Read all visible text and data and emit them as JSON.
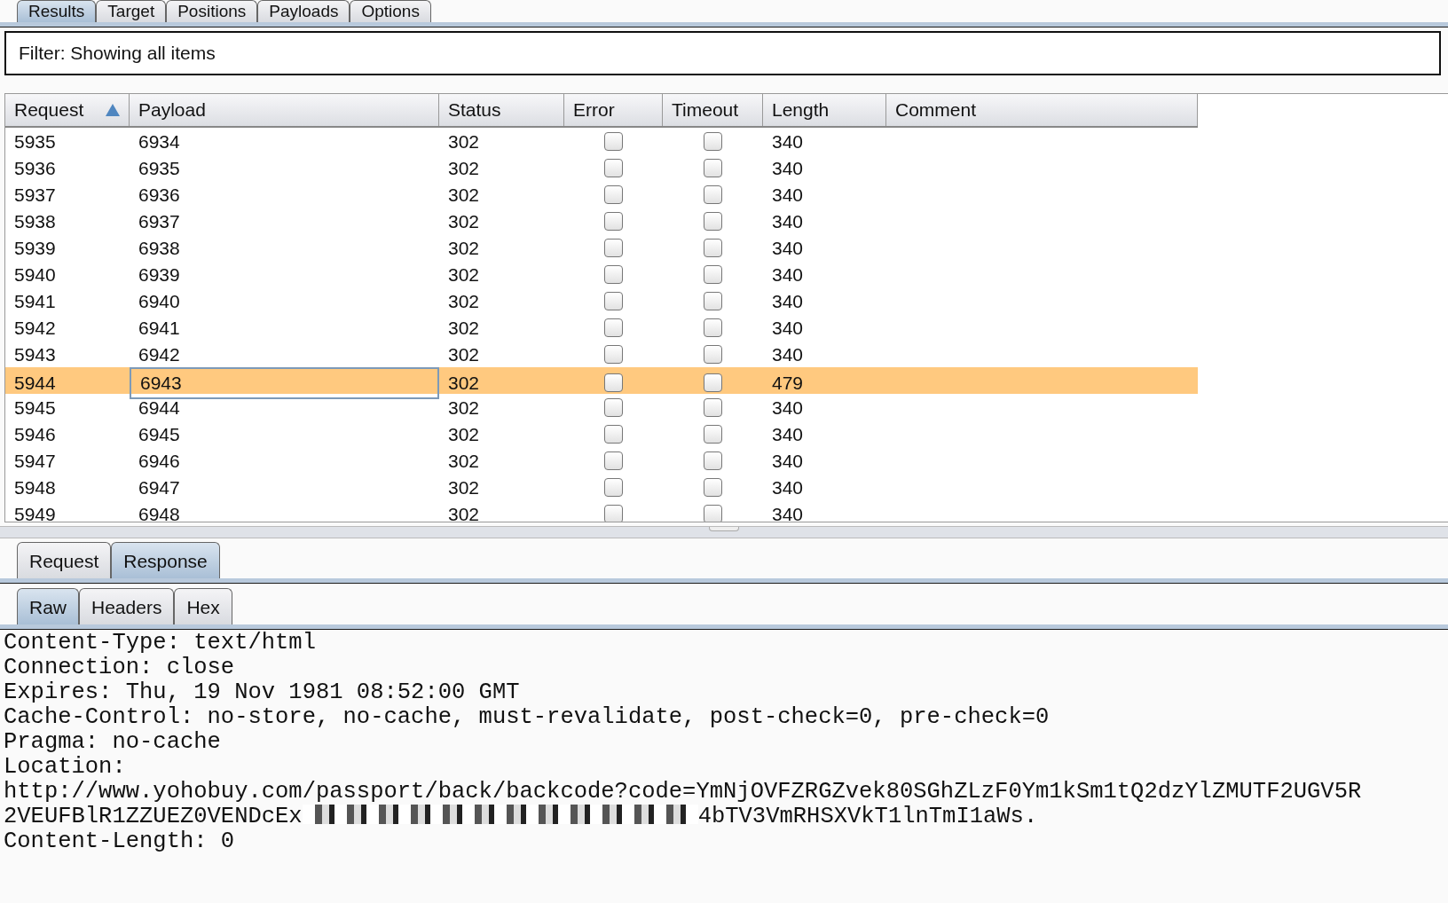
{
  "top_tabs": [
    {
      "label": "Results",
      "selected": true
    },
    {
      "label": "Target",
      "selected": false
    },
    {
      "label": "Positions",
      "selected": false
    },
    {
      "label": "Payloads",
      "selected": false
    },
    {
      "label": "Options",
      "selected": false
    }
  ],
  "filter": "Filter: Showing all items",
  "table": {
    "columns": [
      {
        "label": "Request",
        "sorted": true
      },
      {
        "label": "Payload",
        "sorted": false
      },
      {
        "label": "Status",
        "sorted": false
      },
      {
        "label": "Error",
        "sorted": false
      },
      {
        "label": "Timeout",
        "sorted": false
      },
      {
        "label": "Length",
        "sorted": false
      },
      {
        "label": "Comment",
        "sorted": false
      }
    ],
    "rows": [
      {
        "request": "5935",
        "payload": "6934",
        "status": "302",
        "error": false,
        "timeout": false,
        "length": "340",
        "selected": false
      },
      {
        "request": "5936",
        "payload": "6935",
        "status": "302",
        "error": false,
        "timeout": false,
        "length": "340",
        "selected": false
      },
      {
        "request": "5937",
        "payload": "6936",
        "status": "302",
        "error": false,
        "timeout": false,
        "length": "340",
        "selected": false
      },
      {
        "request": "5938",
        "payload": "6937",
        "status": "302",
        "error": false,
        "timeout": false,
        "length": "340",
        "selected": false
      },
      {
        "request": "5939",
        "payload": "6938",
        "status": "302",
        "error": false,
        "timeout": false,
        "length": "340",
        "selected": false
      },
      {
        "request": "5940",
        "payload": "6939",
        "status": "302",
        "error": false,
        "timeout": false,
        "length": "340",
        "selected": false
      },
      {
        "request": "5941",
        "payload": "6940",
        "status": "302",
        "error": false,
        "timeout": false,
        "length": "340",
        "selected": false
      },
      {
        "request": "5942",
        "payload": "6941",
        "status": "302",
        "error": false,
        "timeout": false,
        "length": "340",
        "selected": false
      },
      {
        "request": "5943",
        "payload": "6942",
        "status": "302",
        "error": false,
        "timeout": false,
        "length": "340",
        "selected": false
      },
      {
        "request": "5944",
        "payload": "6943",
        "status": "302",
        "error": false,
        "timeout": false,
        "length": "479",
        "selected": true
      },
      {
        "request": "5945",
        "payload": "6944",
        "status": "302",
        "error": false,
        "timeout": false,
        "length": "340",
        "selected": false
      },
      {
        "request": "5946",
        "payload": "6945",
        "status": "302",
        "error": false,
        "timeout": false,
        "length": "340",
        "selected": false
      },
      {
        "request": "5947",
        "payload": "6946",
        "status": "302",
        "error": false,
        "timeout": false,
        "length": "340",
        "selected": false
      },
      {
        "request": "5948",
        "payload": "6947",
        "status": "302",
        "error": false,
        "timeout": false,
        "length": "340",
        "selected": false
      },
      {
        "request": "5949",
        "payload": "6948",
        "status": "302",
        "error": false,
        "timeout": false,
        "length": "340",
        "selected": false
      }
    ]
  },
  "message_tabs": [
    {
      "label": "Request",
      "selected": false
    },
    {
      "label": "Response",
      "selected": true
    }
  ],
  "view_tabs": [
    {
      "label": "Raw",
      "selected": true
    },
    {
      "label": "Headers",
      "selected": false
    },
    {
      "label": "Hex",
      "selected": false
    }
  ],
  "response_lines": [
    {
      "kind": "text",
      "text": "Content-Type: text/html"
    },
    {
      "kind": "text",
      "text": "Connection: close"
    },
    {
      "kind": "text",
      "text": "Expires: Thu, 19 Nov 1981 08:52:00 GMT"
    },
    {
      "kind": "text",
      "text": "Cache-Control: no-store, no-cache, must-revalidate, post-check=0, pre-check=0"
    },
    {
      "kind": "text",
      "text": "Pragma: no-cache"
    },
    {
      "kind": "text",
      "text": "Location:"
    },
    {
      "kind": "text",
      "text": "http://www.yohobuy.com/passport/back/backcode?code=YmNjOVFZRGZvek80SGhZLzF0Ym1kSm1tQ2dzYlZMUTF2UGV5R"
    },
    {
      "kind": "redacted",
      "before": "2VEUFBlR1ZZUEZ0VENDcEx",
      "after": "4bTV3VmRHSXVkT1lnTmI1aWs."
    },
    {
      "kind": "text",
      "text": "Content-Length: 0"
    }
  ]
}
